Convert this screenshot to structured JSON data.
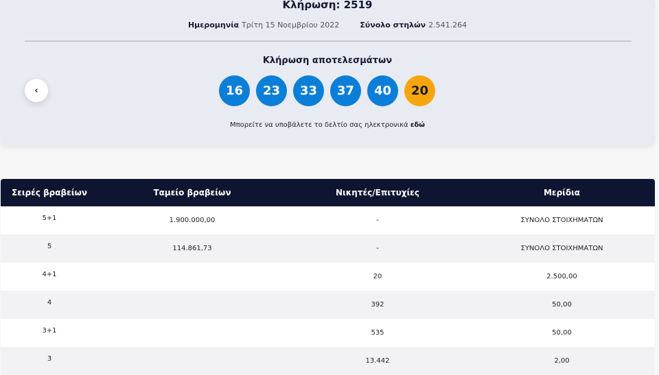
{
  "draw": {
    "title": "Κλήρωση: 2519",
    "date_label": "Ημερομηνία",
    "date_value": "Τρίτη 15 Νοεμβρίου 2022",
    "total_label": "Σύνολο στηλών",
    "total_value": "2.541.264",
    "results_label": "Κλήρωση αποτελεσμάτων",
    "balls": [
      "16",
      "23",
      "33",
      "37",
      "40"
    ],
    "bonus_ball": "20",
    "note_text": "Μπορείτε να υποβάλετε το δελτίο σας ηλεκτρονικά",
    "note_link": "εδώ",
    "prev_icon": "chevron-left-icon",
    "colors": {
      "ball": "#0b7fd8",
      "bonus": "#f6a60b",
      "header": "#0e1530"
    }
  },
  "table": {
    "headers": [
      "Σειρές βραβείων",
      "Ταμείο βραβείων",
      "Νικητές/Επιτυχίες",
      "Μερίδια"
    ],
    "rows": [
      [
        "5+1",
        "1.900.000,00",
        "-",
        "ΣΥΝΟΛΟ ΣΤΟΙΧΗΜΑΤΩΝ"
      ],
      [
        "5",
        "114.861,73",
        "-",
        "ΣΥΝΟΛΟ ΣΤΟΙΧΗΜΑΤΩΝ"
      ],
      [
        "4+1",
        "",
        "20",
        "2.500,00"
      ],
      [
        "4",
        "",
        "392",
        "50,00"
      ],
      [
        "3+1",
        "",
        "535",
        "50,00"
      ],
      [
        "3",
        "",
        "13.442",
        "2,00"
      ]
    ]
  }
}
